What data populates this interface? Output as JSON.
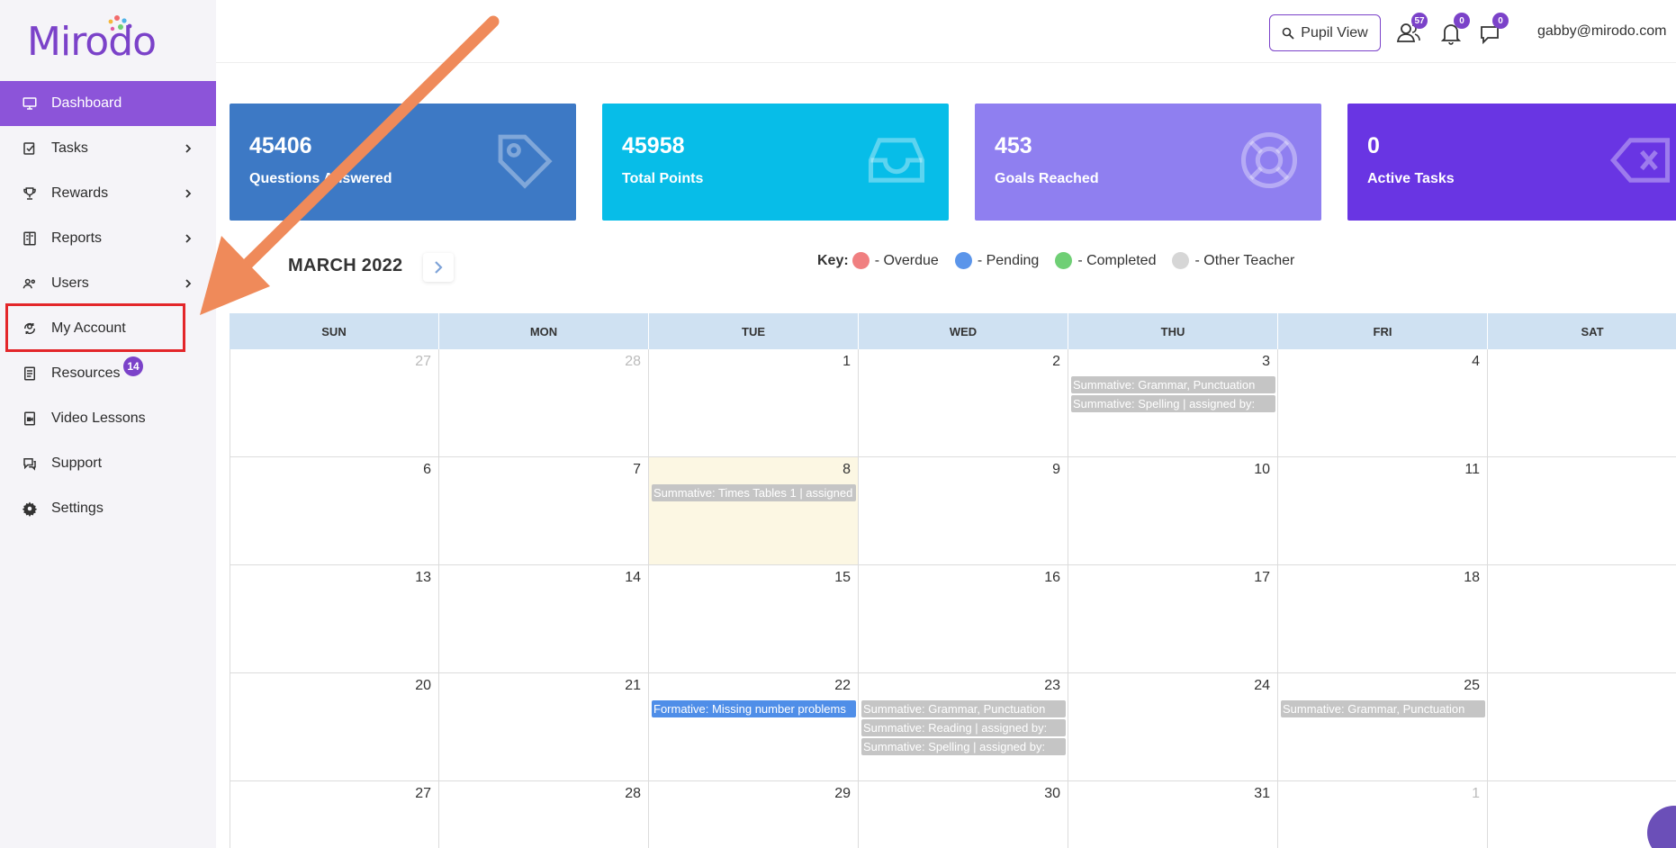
{
  "logo": {
    "text": "Mirodo"
  },
  "sidebar": {
    "items": [
      {
        "label": "Dashboard",
        "icon": "monitor-icon",
        "active": true,
        "chevron": false
      },
      {
        "label": "Tasks",
        "icon": "tasks-icon",
        "chevron": true
      },
      {
        "label": "Rewards",
        "icon": "trophy-icon",
        "chevron": true
      },
      {
        "label": "Reports",
        "icon": "reports-icon",
        "chevron": true
      },
      {
        "label": "Users",
        "icon": "users-icon",
        "chevron": true
      },
      {
        "label": "My Account",
        "icon": "account-icon",
        "chevron": false
      },
      {
        "label": "Resources",
        "icon": "resources-icon",
        "chevron": false,
        "badge": "14"
      },
      {
        "label": "Video Lessons",
        "icon": "video-icon",
        "chevron": false
      },
      {
        "label": "Support",
        "icon": "support-icon",
        "chevron": false
      },
      {
        "label": "Settings",
        "icon": "gear-icon",
        "chevron": false
      }
    ]
  },
  "header": {
    "pupil_view_label": "Pupil View",
    "users_badge": "57",
    "notifications_badge": "0",
    "messages_badge": "0",
    "user_email": "gabby@mirodo.com"
  },
  "stats": [
    {
      "value": "45406",
      "label": "Questions Answered",
      "color": "#3d79c5",
      "icon": "tag-icon"
    },
    {
      "value": "45958",
      "label": "Total Points",
      "color": "#07bde8",
      "icon": "inbox-icon"
    },
    {
      "value": "453",
      "label": "Goals Reached",
      "color": "#8f7ff0",
      "icon": "lifebuoy-icon"
    },
    {
      "value": "0",
      "label": "Active Tasks",
      "color": "#6935e3",
      "icon": "backspace-icon"
    }
  ],
  "calendar": {
    "month_label": "MARCH 2022",
    "key": {
      "title": "Key:",
      "items": [
        {
          "label": "- Overdue",
          "color": "#f07f80"
        },
        {
          "label": "- Pending",
          "color": "#5b95ea"
        },
        {
          "label": "- Completed",
          "color": "#6fcf75"
        },
        {
          "label": "- Other Teacher",
          "color": "#d6d6d6"
        }
      ]
    },
    "weekdays": [
      "SUN",
      "MON",
      "TUE",
      "WED",
      "THU",
      "FRI",
      "SAT"
    ],
    "weeks": [
      [
        {
          "day": "27",
          "muted": true
        },
        {
          "day": "28",
          "muted": true
        },
        {
          "day": "1"
        },
        {
          "day": "2"
        },
        {
          "day": "3",
          "events": [
            {
              "text": "Summative: Grammar, Punctuation",
              "type": "other"
            },
            {
              "text": "Summative: Spelling | assigned by: ",
              "type": "other"
            }
          ]
        },
        {
          "day": "4"
        },
        {
          "day": ""
        }
      ],
      [
        {
          "day": "6"
        },
        {
          "day": "7"
        },
        {
          "day": "8",
          "today": true,
          "events": [
            {
              "text": "Summative: Times Tables 1 | assigned",
              "type": "other"
            }
          ]
        },
        {
          "day": "9"
        },
        {
          "day": "10"
        },
        {
          "day": "11"
        },
        {
          "day": ""
        }
      ],
      [
        {
          "day": "13"
        },
        {
          "day": "14"
        },
        {
          "day": "15"
        },
        {
          "day": "16"
        },
        {
          "day": "17"
        },
        {
          "day": "18"
        },
        {
          "day": ""
        }
      ],
      [
        {
          "day": "20"
        },
        {
          "day": "21"
        },
        {
          "day": "22",
          "events": [
            {
              "text": "Formative: Missing number problems",
              "type": "pending"
            }
          ]
        },
        {
          "day": "23",
          "events": [
            {
              "text": "Summative: Grammar, Punctuation",
              "type": "other"
            },
            {
              "text": "Summative: Reading | assigned by: ",
              "type": "other"
            },
            {
              "text": "Summative: Spelling | assigned by: ",
              "type": "other"
            }
          ]
        },
        {
          "day": "24"
        },
        {
          "day": "25",
          "events": [
            {
              "text": "Summative: Grammar, Punctuation",
              "type": "other"
            }
          ]
        },
        {
          "day": ""
        }
      ],
      [
        {
          "day": "27"
        },
        {
          "day": "28"
        },
        {
          "day": "29"
        },
        {
          "day": "30"
        },
        {
          "day": "31"
        },
        {
          "day": "1",
          "muted": true
        },
        {
          "day": ""
        }
      ]
    ]
  }
}
